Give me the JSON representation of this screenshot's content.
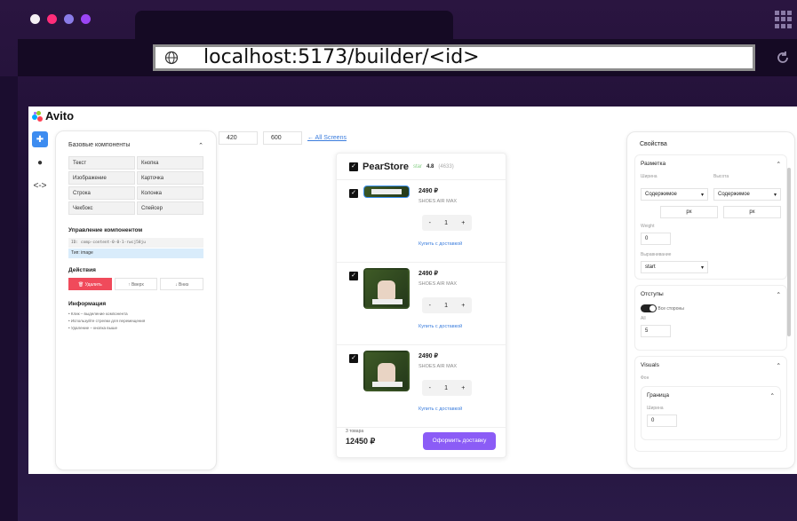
{
  "browser": {
    "url": "localhost:5173/builder/<id>",
    "dot_colors": [
      "#f5f0f5",
      "#ff2d7a",
      "#8a7ce8",
      "#9b45f5"
    ]
  },
  "app": {
    "logo": "Avito",
    "rail_icons": [
      "puzzle-icon",
      "palette-icon",
      "code-icon"
    ]
  },
  "components_panel": {
    "title": "Базовые компоненты",
    "items": [
      "Текст",
      "Кнопка",
      "Изображение",
      "Карточка",
      "Строка",
      "Колонка",
      "Чекбокс",
      "Спейсер"
    ],
    "management_title": "Управление компонентом",
    "id_line": "ID: comp-content-0-0-1-rwcj58ju",
    "type_line": "Тип: image",
    "actions_title": "Действия",
    "delete_label": "Удалить",
    "up_label": "↑ Вверх",
    "down_label": "↓ Вниз",
    "info_title": "Информация",
    "info_lines": [
      "• Клик – выделение компонента",
      "• Используйте стрелки для перемещения",
      "• Удаление – кнопка выше"
    ]
  },
  "screen_size": {
    "width": "420",
    "height": "600",
    "all_screens": "← All Screens"
  },
  "preview": {
    "store_name": "PearStore",
    "star_label": "star",
    "rating": "4.8",
    "reviews": "(4633)",
    "items": [
      {
        "price": "2490 ₽",
        "name": "SHOES AIR MAX",
        "qty": "1",
        "buy": "Купить с доставкой"
      },
      {
        "price": "2490 ₽",
        "name": "SHOES AIR MAX",
        "qty": "1",
        "buy": "Купить с доставкой"
      },
      {
        "price": "2490 ₽",
        "name": "SHOES AIR MAX",
        "qty": "1",
        "buy": "Купить с доставкой"
      }
    ],
    "count_label": "3 товара",
    "total": "12450 ₽",
    "order_button": "Оформить доставку"
  },
  "properties": {
    "title": "Свойства",
    "layout_title": "Разметка",
    "width_label": "Ширина",
    "height_label": "Высота",
    "width_value": "Содержимое",
    "height_value": "Содержимое",
    "unit_px": "px",
    "weight_label": "Weight",
    "weight_value": "0",
    "align_label": "Выравнивание",
    "align_value": "start",
    "padding_title": "Отступы",
    "all_sides_label": "Все стороны",
    "all_label": "All",
    "all_value": "5",
    "visuals_title": "Visuals",
    "bg_label": "Фон",
    "border_title": "Граница",
    "border_width_label": "Ширина",
    "border_width_value": "0"
  }
}
